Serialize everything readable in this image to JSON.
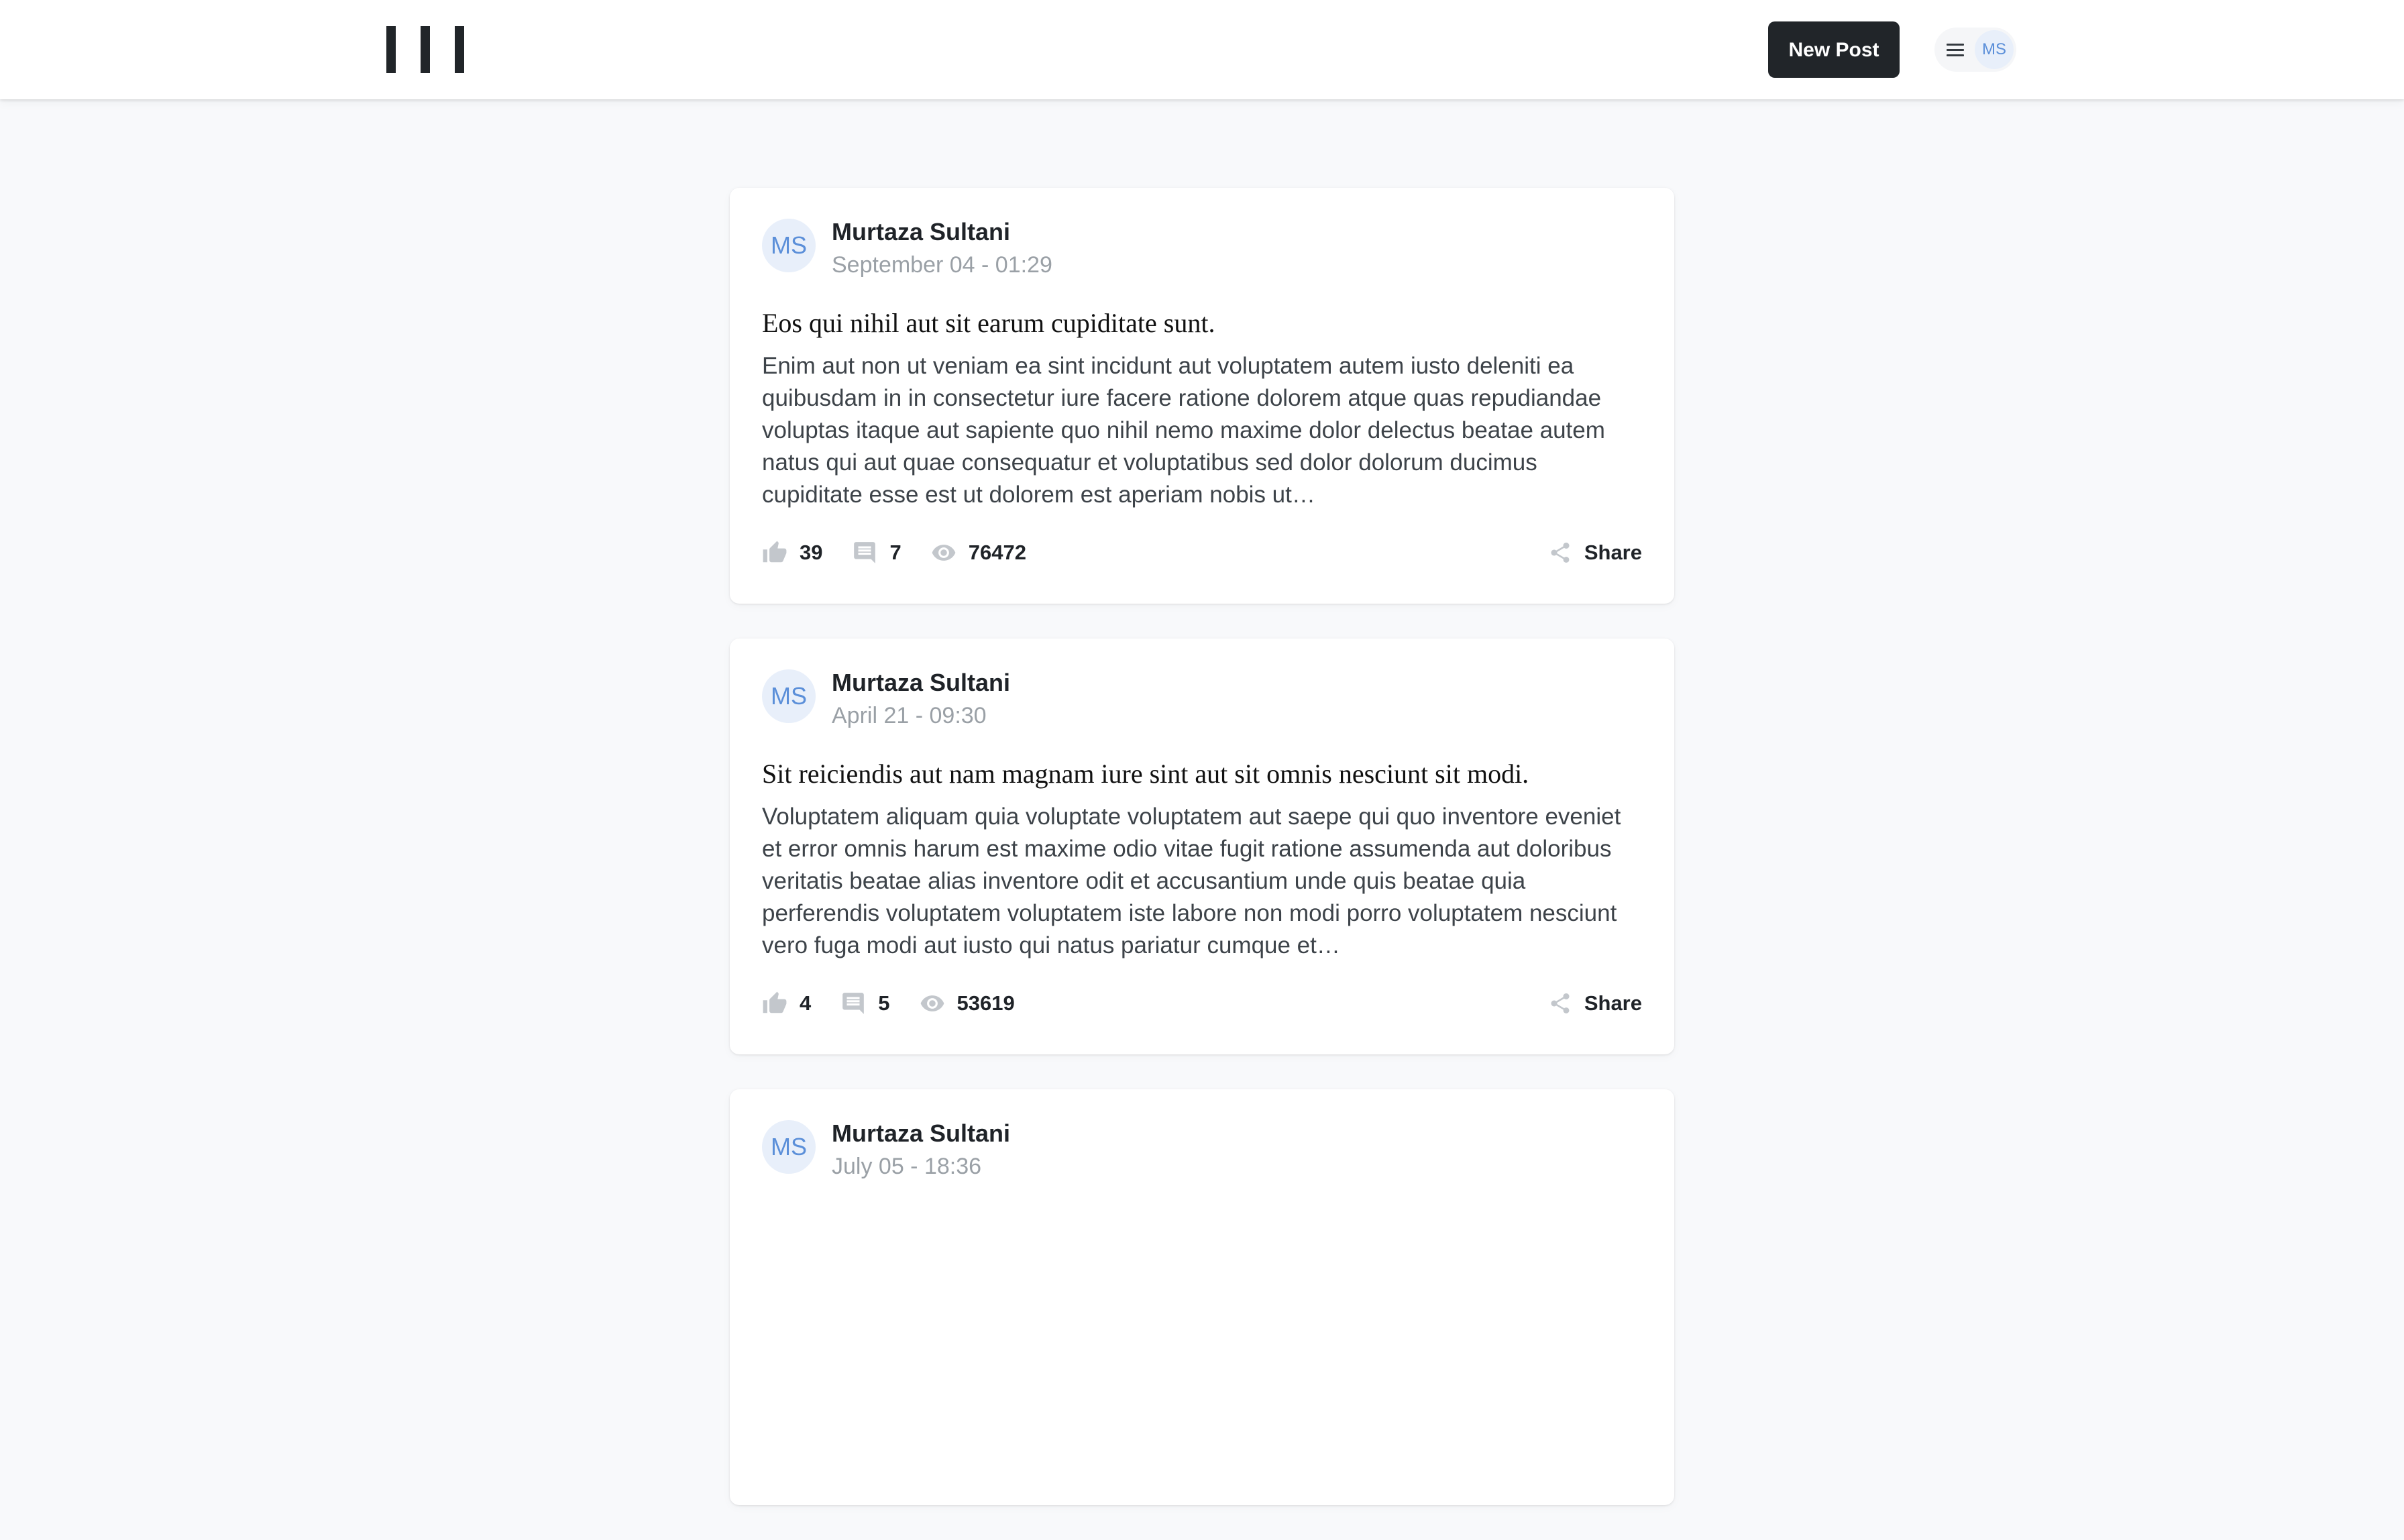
{
  "header": {
    "new_post_label": "New Post",
    "user_initials": "MS"
  },
  "posts": [
    {
      "author_initials": "MS",
      "author": "Murtaza Sultani",
      "date": "September 04 - 01:29",
      "title": "Eos qui nihil aut sit earum cupiditate sunt.",
      "body": "Enim aut non ut veniam ea sint incidunt aut voluptatem autem iusto deleniti ea quibusdam in in consectetur iure facere ratione dolorem atque quas repudiandae voluptas itaque aut sapiente quo nihil nemo maxime dolor delectus beatae autem natus qui aut quae consequatur et voluptatibus sed dolor dolorum ducimus cupiditate esse est ut dolorem est aperiam nobis ut…",
      "likes": "39",
      "comments": "7",
      "views": "76472",
      "share_label": "Share"
    },
    {
      "author_initials": "MS",
      "author": "Murtaza Sultani",
      "date": "April 21 - 09:30",
      "title": "Sit reiciendis aut nam magnam iure sint aut sit omnis nesciunt sit modi.",
      "body": "Voluptatem aliquam quia voluptate voluptatem aut saepe qui quo inventore eveniet et error omnis harum est maxime odio vitae fugit ratione assumenda aut doloribus veritatis beatae alias inventore odit et accusantium unde quis beatae quia perferendis voluptatem voluptatem iste labore non modi porro voluptatem nesciunt vero fuga modi aut iusto qui natus pariatur cumque et…",
      "likes": "4",
      "comments": "5",
      "views": "53619",
      "share_label": "Share"
    },
    {
      "author_initials": "MS",
      "author": "Murtaza Sultani",
      "date": "July 05 - 18:36"
    }
  ],
  "icons": {
    "logo": "logo-bars-icon",
    "menu": "hamburger-menu-icon",
    "like": "thumbs-up-icon",
    "comment": "comment-bubble-icon",
    "views": "eye-icon",
    "share": "share-icon"
  },
  "colors": {
    "header_bg": "#ffffff",
    "page_bg": "#f8f9fb",
    "primary_button": "#212529",
    "avatar_bg": "#e8effa",
    "avatar_text": "#5b8fd9",
    "muted_text": "#9aa0a6",
    "icon_gray": "#c3c7cc"
  }
}
